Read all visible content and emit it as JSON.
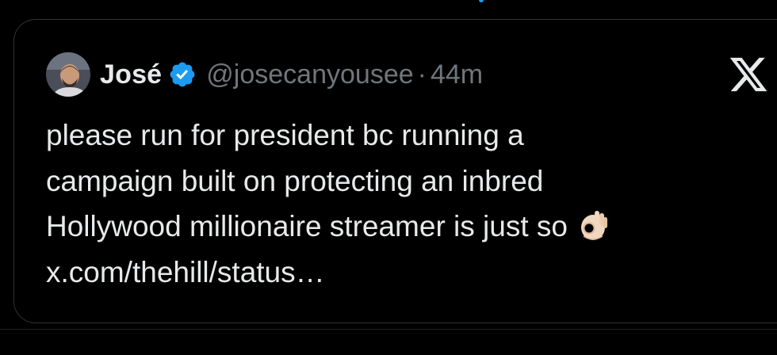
{
  "tweet": {
    "author_name": "José",
    "handle": "@josecanyousee",
    "separator": "·",
    "timestamp": "44m",
    "body_lines": [
      "please run for president bc running a",
      "campaign built on protecting an inbred",
      "Hollywood millionaire streamer is just so",
      "x.com/thehill/status…"
    ],
    "emoji": "ok-hand-emoji",
    "verified_badge": "verified-icon"
  },
  "icons": {
    "platform_logo": "x-logo-icon"
  },
  "colors": {
    "background": "#000000",
    "text_primary": "#e7e9ea",
    "text_secondary": "#71767b",
    "verified": "#1d9bf0",
    "border": "#2f3336"
  }
}
